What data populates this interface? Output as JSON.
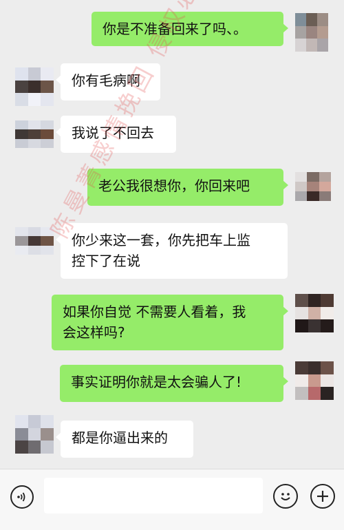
{
  "messages": [
    {
      "side": "right",
      "text": "你是不准备回来了吗、。"
    },
    {
      "side": "left",
      "text": "你有毛病啊"
    },
    {
      "side": "left",
      "text": "我说了不回去"
    },
    {
      "side": "right",
      "text": "老公我很想你，你回来吧"
    },
    {
      "side": "left",
      "text": "你少来这一套，你先把车上监\n控下了在说"
    },
    {
      "side": "right",
      "text": "如果你自觉 不需要人看着，我\n会这样吗?"
    },
    {
      "side": "right",
      "text": "事实证明你就是太会骗人了!"
    },
    {
      "side": "left",
      "text": "都是你逼出来的"
    }
  ],
  "watermark": "陈曼菁感情挽回 侵权必究",
  "input_bar": {
    "voice_icon": "voice-icon",
    "emoji_icon": "emoji-icon",
    "plus_icon": "plus-icon"
  },
  "colors": {
    "my_bubble": "#95ec69",
    "their_bubble": "#ffffff",
    "background": "#ededed"
  }
}
